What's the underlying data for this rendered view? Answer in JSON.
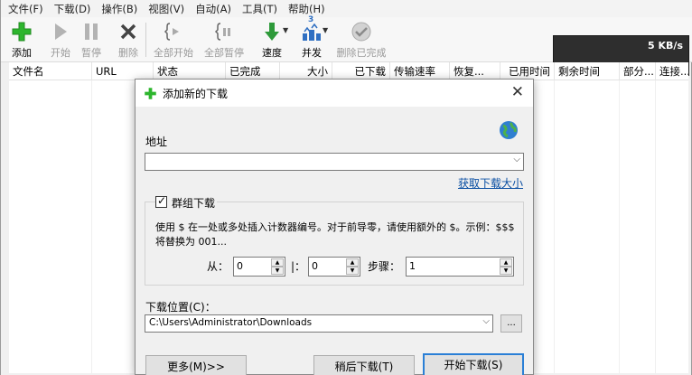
{
  "menu": [
    "文件(F)",
    "下载(D)",
    "操作(B)",
    "视图(V)",
    "自动(A)",
    "工具(T)",
    "帮助(H)"
  ],
  "toolbar": {
    "add": "添加",
    "start": "开始",
    "pause": "暂停",
    "delete": "删除",
    "start_all": "全部开始",
    "pause_all": "全部暂停",
    "speed": "速度",
    "concurrency": "并发",
    "concurrency_badge": "3",
    "delete_completed": "删除已完成",
    "speed_readout": "5 KB/s"
  },
  "columns": [
    "文件名",
    "URL",
    "状态",
    "已完成",
    "大小",
    "已下载",
    "传输速率",
    "恢复...",
    "已用时间",
    "剩余时间",
    "部分...",
    "连接..."
  ],
  "dialog": {
    "title": "添加新的下载",
    "close": "✕",
    "address_label": "地址",
    "address_value": "",
    "get_size_link": "获取下载大小",
    "batch_label": "群组下载",
    "batch_checked": "✓",
    "batch_help": "使用 $ 在一处或多处插入计数器编号。对于前导零，请使用额外的 $。示例：$$$ 将替换为 001...",
    "from_label": "从：",
    "from_value": "0",
    "to_label": "|：",
    "to_value": "0",
    "step_label": "步骤：",
    "step_value": "1",
    "location_label": "下载位置(C)：",
    "location_value": "C:\\Users\\Administrator\\Downloads",
    "browse": "...",
    "more_button": "更多(M)>>",
    "later_button": "稍后下载(T)",
    "start_button": "开始下载(S)"
  },
  "colors": {
    "accent": "#2a7fd6",
    "link": "#0a4fa3",
    "add_green": "#2db52d",
    "speed_green": "#2e9a3a",
    "concurrency_blue": "#2f6fc2"
  }
}
